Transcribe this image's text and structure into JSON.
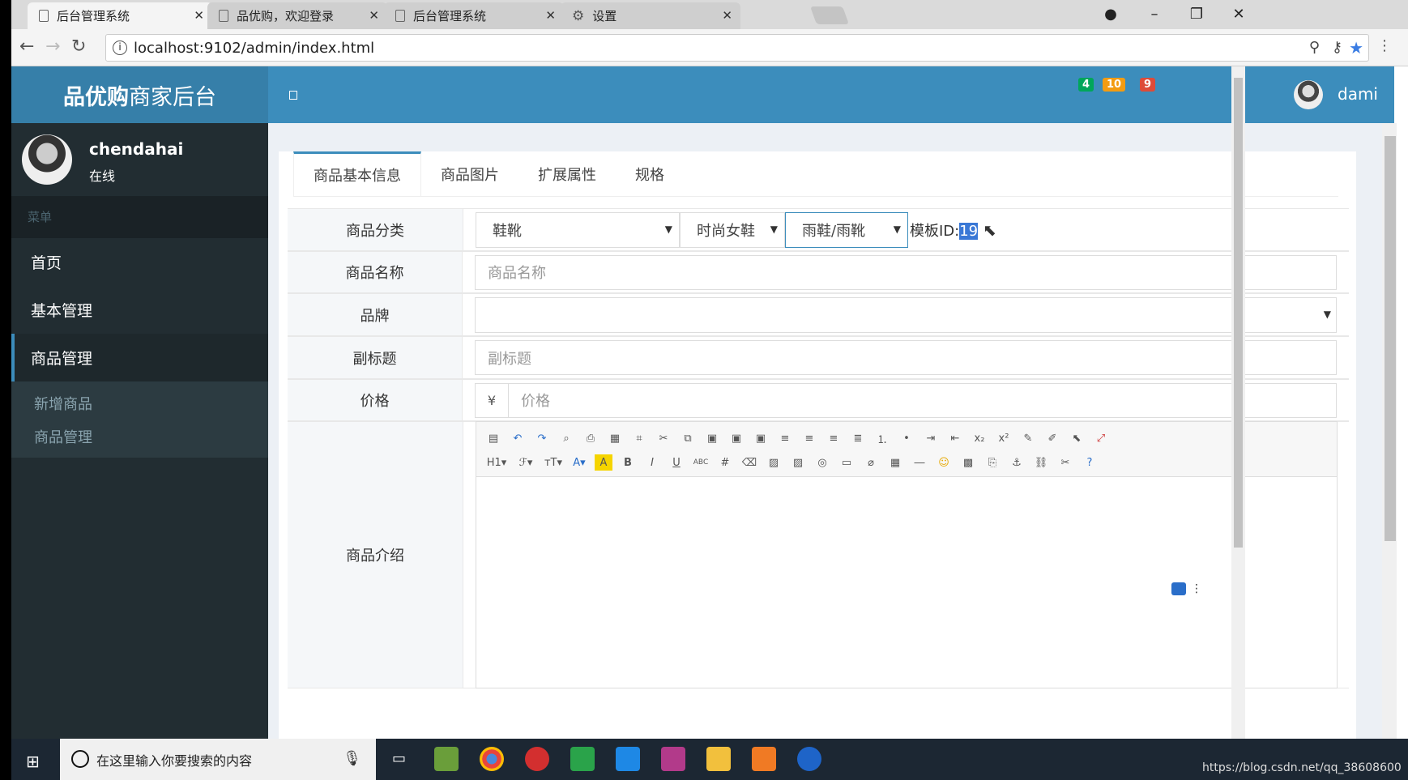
{
  "browser": {
    "tabs": [
      {
        "label": "后台管理系统",
        "close": "✕",
        "active": true
      },
      {
        "label": "品优购，欢迎登录",
        "close": "✕",
        "active": false
      },
      {
        "label": "后台管理系统",
        "close": "✕",
        "active": false
      },
      {
        "label": "设置",
        "close": "✕",
        "active": false
      }
    ],
    "url": "localhost:9102/admin/index.html"
  },
  "header": {
    "brand_bold": "品优购",
    "brand_rest": "商家后台",
    "badges": [
      {
        "value": "4",
        "color": "#00a65a"
      },
      {
        "value": "10",
        "color": "#f39c12"
      },
      {
        "value": "9",
        "color": "#dd4b39"
      }
    ],
    "username": "dami"
  },
  "sidebar": {
    "user_name": "chendahai",
    "user_status": "在线",
    "menu_header": "菜单",
    "items": [
      {
        "label": "首页"
      },
      {
        "label": "基本管理"
      },
      {
        "label": "商品管理"
      }
    ],
    "subitems": [
      {
        "label": "新增商品"
      },
      {
        "label": "商品管理"
      }
    ]
  },
  "content": {
    "tabs": [
      {
        "label": "商品基本信息"
      },
      {
        "label": "商品图片"
      },
      {
        "label": "扩展属性"
      },
      {
        "label": "规格"
      }
    ],
    "form": {
      "category_label": "商品分类",
      "category1": "鞋靴",
      "category2": "时尚女鞋",
      "category3": "雨鞋/雨靴",
      "template_prefix": "模板ID:",
      "template_id": "19",
      "name_label": "商品名称",
      "name_placeholder": "商品名称",
      "brand_label": "品牌",
      "subtitle_label": "副标题",
      "subtitle_placeholder": "副标题",
      "price_label": "价格",
      "price_prefix": "¥",
      "price_placeholder": "价格",
      "intro_label": "商品介绍"
    }
  },
  "taskbar": {
    "search_placeholder": "在这里输入你要搜索的内容",
    "watermark_url": "https://blog.csdn.net/qq_38608600"
  }
}
